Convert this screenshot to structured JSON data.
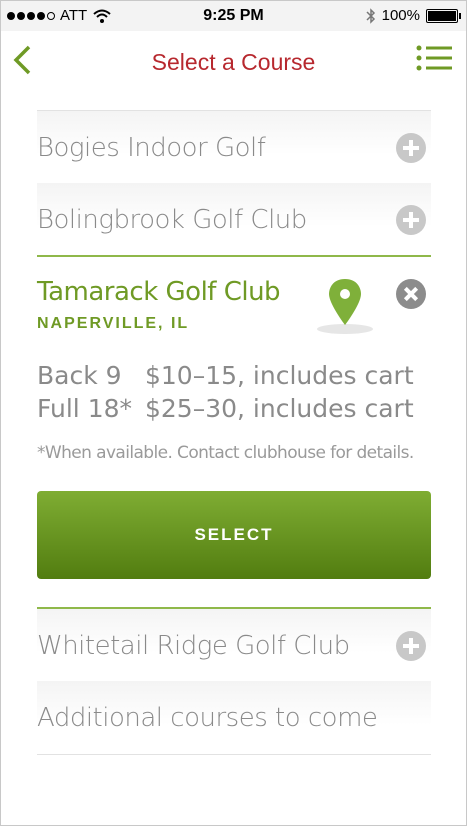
{
  "status_bar": {
    "carrier": "ATT",
    "time": "9:25 PM",
    "battery": "100%"
  },
  "nav": {
    "title": "Select a Course"
  },
  "courses": [
    {
      "name": "Bogies Indoor Golf"
    },
    {
      "name": "Bolingbrook Golf Club"
    }
  ],
  "selected_course": {
    "name": "Tamarack Golf Club",
    "city": "NAPERVILLE, IL",
    "prices": [
      {
        "label": "Back 9",
        "value": "$10–15, includes cart"
      },
      {
        "label": "Full 18*",
        "value": "$25–30, includes cart"
      }
    ],
    "note": "*When available. Contact clubhouse for details.",
    "select_label": "SELECT"
  },
  "more_courses": [
    {
      "name": "Whitetail Ridge Golf Club"
    },
    {
      "name": "Additional courses to come"
    }
  ],
  "colors": {
    "accent_green": "#6f9a25",
    "title_red": "#b7282e"
  }
}
